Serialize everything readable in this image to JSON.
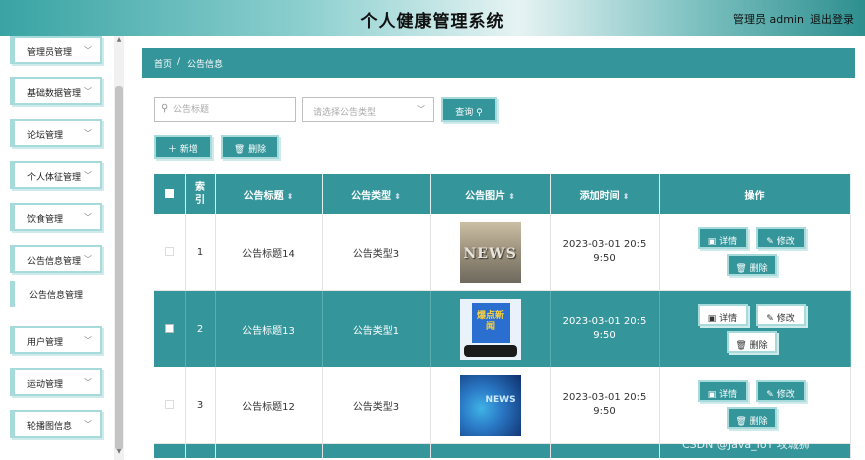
{
  "header": {
    "title": "个人健康管理系统",
    "user": "管理员 admin",
    "logout": "退出登录"
  },
  "sidebar": {
    "items": [
      {
        "label": "管理员管理"
      },
      {
        "label": "基础数据管理"
      },
      {
        "label": "论坛管理"
      },
      {
        "label": "个人体征管理"
      },
      {
        "label": "饮食管理"
      },
      {
        "label": "公告信息管理"
      },
      {
        "label": "用户管理"
      },
      {
        "label": "运动管理"
      },
      {
        "label": "轮播图信息"
      }
    ],
    "sub_item": "公告信息管理"
  },
  "breadcrumb": {
    "home": "首页",
    "sep": "/",
    "current": "公告信息"
  },
  "search": {
    "title_placeholder": "公告标题",
    "type_placeholder": "请选择公告类型",
    "search_label": "查询",
    "add_label": "新增",
    "delete_label": "删除"
  },
  "table": {
    "headers": [
      "索引",
      "公告标题",
      "公告类型",
      "公告图片",
      "添加时间",
      "操作"
    ],
    "rows": [
      {
        "index": "1",
        "title": "公告标题14",
        "type": "公告类型3",
        "image": "NEWS",
        "time": "2023-03-01 20:59:50"
      },
      {
        "index": "2",
        "title": "公告标题13",
        "type": "公告类型1",
        "image": "爆点新闻",
        "time": "2023-03-01 20:59:50"
      },
      {
        "index": "3",
        "title": "公告标题12",
        "type": "公告类型3",
        "image": "NEWS",
        "time": "2023-03-01 20:59:50"
      }
    ],
    "actions": {
      "detail": "详情",
      "edit": "修改",
      "delete": "删除"
    }
  },
  "watermark": "CSDN @Java_IoT 攻城狮"
}
